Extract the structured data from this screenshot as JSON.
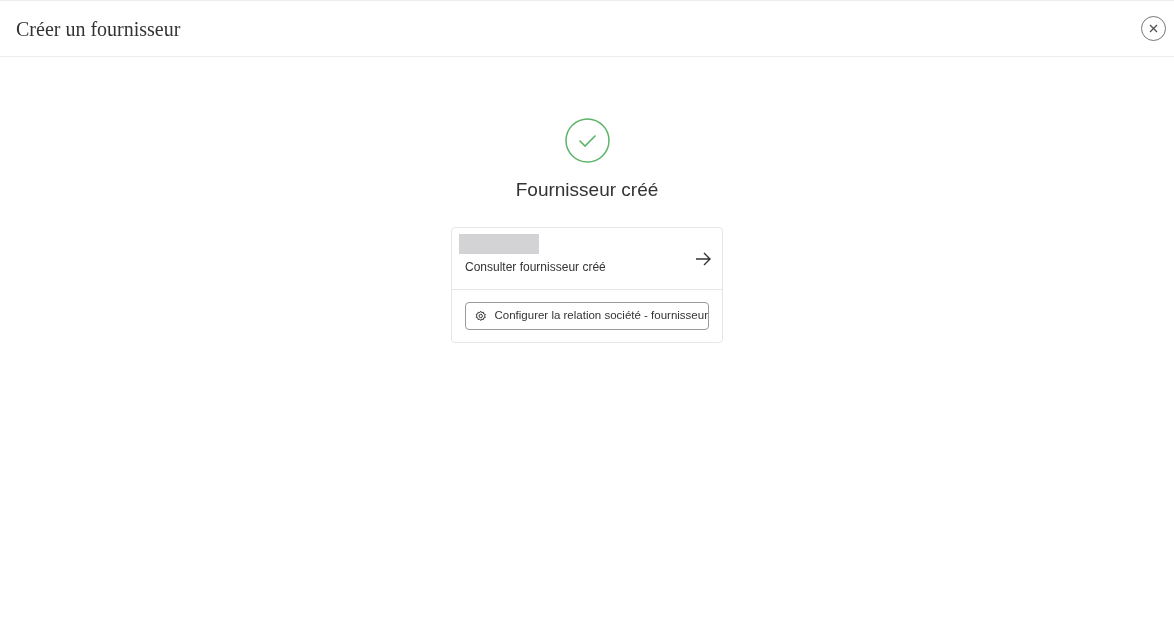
{
  "dialog": {
    "title": "Créer un fournisseur"
  },
  "result": {
    "heading": "Fournisseur créé"
  },
  "card": {
    "link_label": "Consulter fournisseur créé",
    "action_button": "Configurer la relation société - fournisseur"
  }
}
